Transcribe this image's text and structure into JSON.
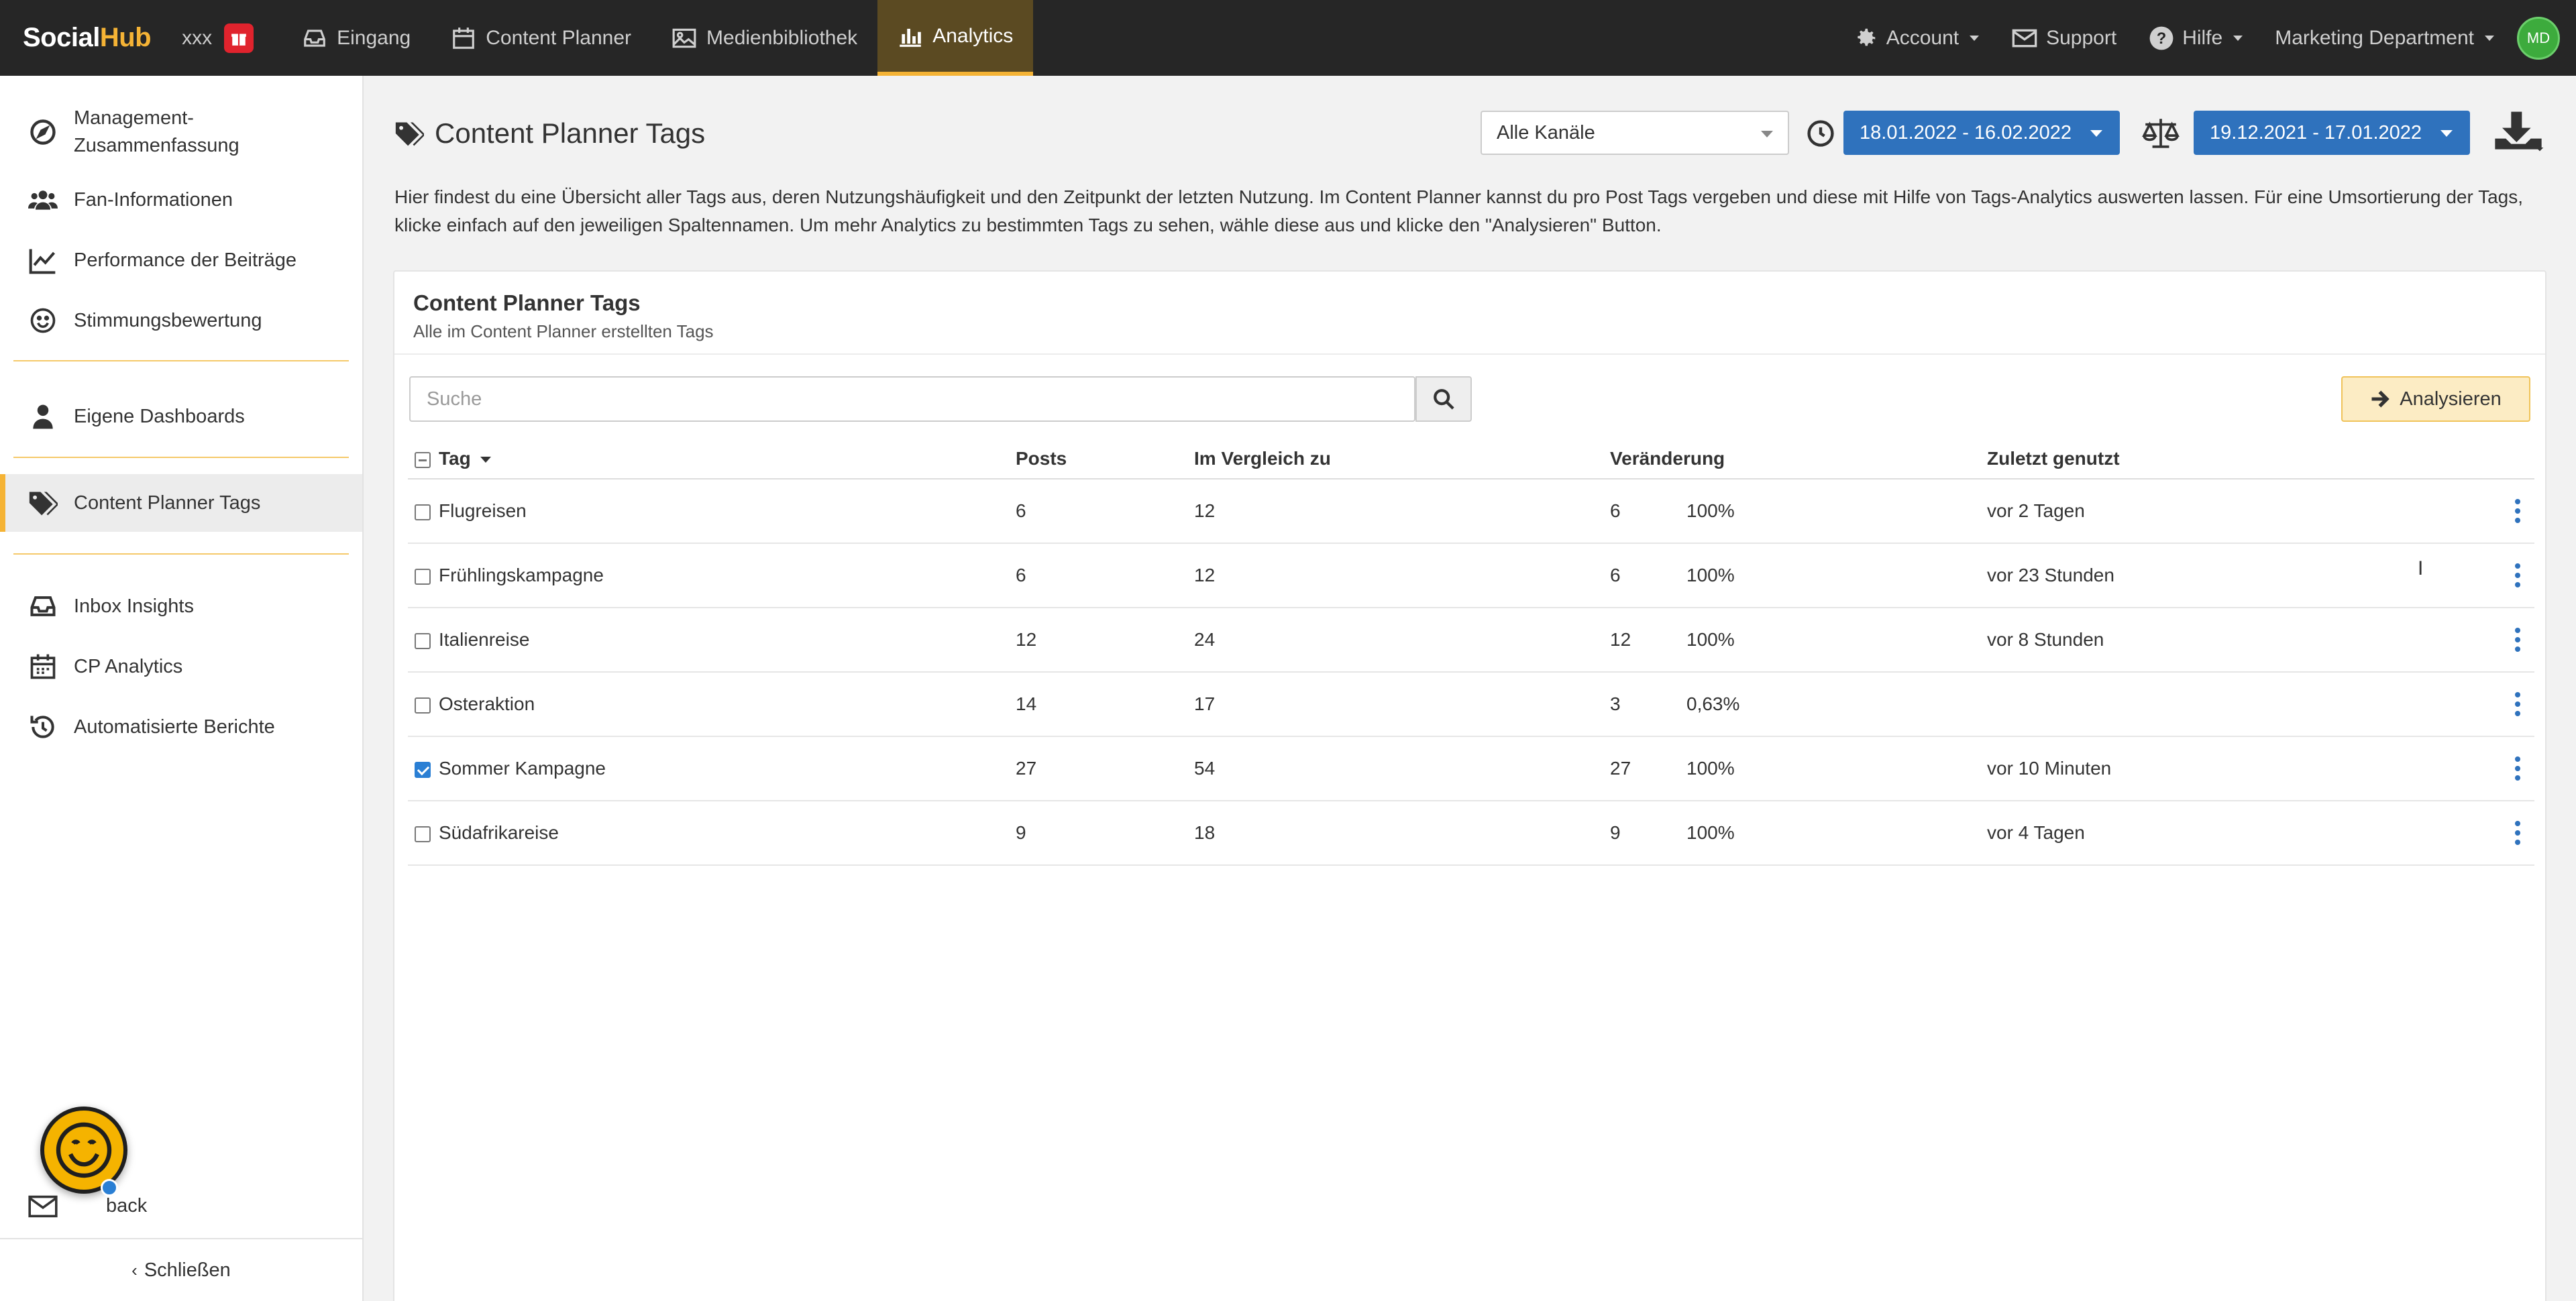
{
  "brand": {
    "name_part1": "Social",
    "name_part2": "Hub",
    "accent": "#f5b335"
  },
  "workspace": {
    "name": "xxx",
    "icon": "gift-icon"
  },
  "nav": [
    {
      "label": "Eingang",
      "icon": "inbox-icon"
    },
    {
      "label": "Content Planner",
      "icon": "calendar-icon"
    },
    {
      "label": "Medienbibliothek",
      "icon": "image-icon"
    },
    {
      "label": "Analytics",
      "icon": "bar-chart-icon",
      "active": true
    }
  ],
  "right_nav": {
    "account": "Account",
    "support": "Support",
    "help": "Hilfe",
    "department": "Marketing Department",
    "avatar": "MD"
  },
  "sidebar": {
    "items": [
      {
        "label_line1": "Management-",
        "label_line2": "Zusammenfassung",
        "icon": "compass-icon"
      },
      {
        "label": "Fan-Informationen",
        "icon": "users-icon"
      },
      {
        "label": "Performance der Beiträge",
        "icon": "line-chart-icon"
      },
      {
        "label": "Stimmungsbewertung",
        "icon": "smile-icon"
      },
      {
        "label": "Eigene Dashboards",
        "icon": "user-icon"
      },
      {
        "label": "Content Planner Tags",
        "icon": "tags-icon",
        "active": true
      },
      {
        "label": "Inbox Insights",
        "icon": "inbox-icon"
      },
      {
        "label": "CP Analytics",
        "icon": "calendar-icon"
      },
      {
        "label": "Automatisierte Berichte",
        "icon": "history-icon"
      },
      {
        "label": "back",
        "icon": "envelope-icon"
      }
    ],
    "close_label": "Schließen"
  },
  "header": {
    "title": "Content Planner Tags",
    "channel_select": "Alle Kanäle",
    "date_range": "18.01.2022 - 16.02.2022",
    "compare_range": "19.12.2021 - 17.01.2022"
  },
  "description": "Hier findest du eine Übersicht aller Tags aus, deren Nutzungshäufigkeit und den Zeitpunkt der letzten Nutzung. Im Content Planner kannst du pro Post Tags vergeben und diese mit Hilfe von Tags-Analytics auswerten lassen. Für eine Umsortierung der Tags, klicke einfach auf den jeweiligen Spaltennamen. Um mehr Analytics zu bestimmten Tags zu sehen, wähle diese aus und klicke den \"Analysieren\" Button.",
  "card": {
    "title": "Content Planner Tags",
    "subtitle": "Alle im Content Planner erstellten Tags",
    "search_placeholder": "Suche",
    "analyze_label": "Analysieren"
  },
  "table": {
    "columns": [
      "Tag",
      "Posts",
      "Im Vergleich zu",
      "Veränderung",
      "Zuletzt genutzt"
    ],
    "rows": [
      {
        "tag": "Flugreisen",
        "posts": "6",
        "compare": "12",
        "change": "6",
        "percent": "100%",
        "last_used": "vor 2 Tagen",
        "checked": false
      },
      {
        "tag": "Frühlingskampagne",
        "posts": "6",
        "compare": "12",
        "change": "6",
        "percent": "100%",
        "last_used": "vor 23 Stunden",
        "checked": false
      },
      {
        "tag": "Italienreise",
        "posts": "12",
        "compare": "24",
        "change": "12",
        "percent": "100%",
        "last_used": "vor 8 Stunden",
        "checked": false
      },
      {
        "tag": "Osteraktion",
        "posts": "14",
        "compare": "17",
        "change": "3",
        "percent": "0,63%",
        "last_used": "",
        "checked": false
      },
      {
        "tag": "Sommer Kampagne",
        "posts": "27",
        "compare": "54",
        "change": "27",
        "percent": "100%",
        "last_used": "vor 10 Minuten",
        "checked": true
      },
      {
        "tag": "Südafrikareise",
        "posts": "9",
        "compare": "18",
        "change": "9",
        "percent": "100%",
        "last_used": "vor 4 Tagen",
        "checked": false
      }
    ]
  }
}
